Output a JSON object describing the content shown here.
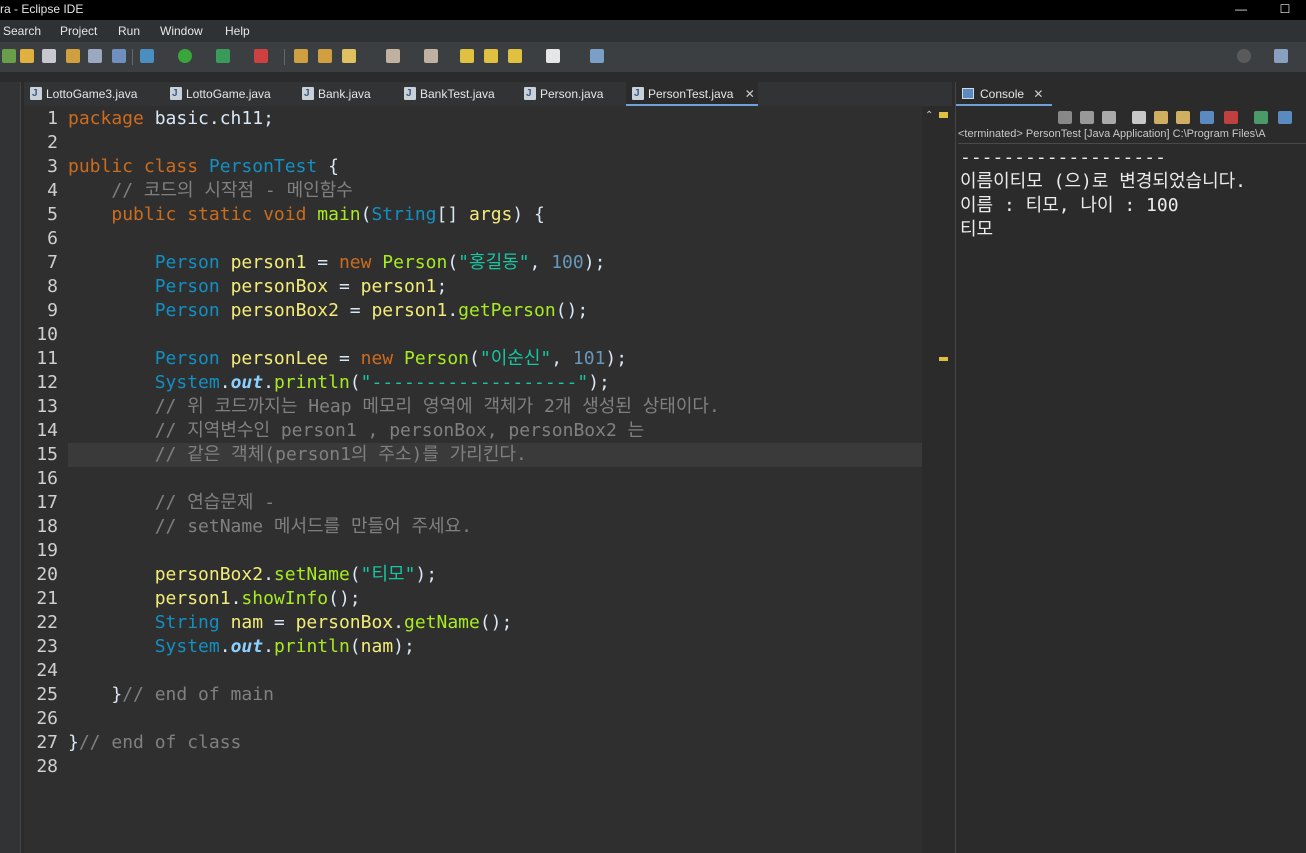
{
  "window": {
    "title": "ra - Eclipse IDE",
    "minimize": "—",
    "maximize": "☐"
  },
  "menu": [
    "Search",
    "Project",
    "Run",
    "Window",
    "Help"
  ],
  "editor_tabs": [
    {
      "label": "LottoGame3.java",
      "active": false
    },
    {
      "label": "LottoGame.java",
      "active": false
    },
    {
      "label": "Bank.java",
      "active": false
    },
    {
      "label": "BankTest.java",
      "active": false
    },
    {
      "label": "Person.java",
      "active": false
    },
    {
      "label": "PersonTest.java",
      "active": true
    }
  ],
  "tab_close": "✕",
  "code_lines": [
    {
      "n": "1",
      "tokens": [
        [
          "kw",
          "package"
        ],
        [
          "plain",
          " basic.ch11;"
        ]
      ]
    },
    {
      "n": "2",
      "tokens": []
    },
    {
      "n": "3",
      "tokens": [
        [
          "kw",
          "public class "
        ],
        [
          "cls",
          "PersonTest"
        ],
        [
          "plain",
          " {"
        ]
      ]
    },
    {
      "n": "4",
      "tokens": [
        [
          "plain",
          "    "
        ],
        [
          "cm",
          "// 코드의 시작점 - 메인함수"
        ]
      ]
    },
    {
      "n": "5",
      "tokens": [
        [
          "plain",
          "    "
        ],
        [
          "kw",
          "public static void "
        ],
        [
          "mth",
          "main"
        ],
        [
          "plain",
          "("
        ],
        [
          "ty",
          "String"
        ],
        [
          "plain",
          "[] "
        ],
        [
          "var",
          "args"
        ],
        [
          "plain",
          ") {"
        ]
      ]
    },
    {
      "n": "6",
      "tokens": []
    },
    {
      "n": "7",
      "tokens": [
        [
          "plain",
          "        "
        ],
        [
          "ty",
          "Person "
        ],
        [
          "var",
          "person1"
        ],
        [
          "plain",
          " = "
        ],
        [
          "kw",
          "new "
        ],
        [
          "mth",
          "Person"
        ],
        [
          "plain",
          "("
        ],
        [
          "str",
          "\"홍길동\""
        ],
        [
          "plain",
          ", "
        ],
        [
          "num",
          "100"
        ],
        [
          "plain",
          ");"
        ]
      ]
    },
    {
      "n": "8",
      "tokens": [
        [
          "plain",
          "        "
        ],
        [
          "ty",
          "Person "
        ],
        [
          "var",
          "personBox"
        ],
        [
          "plain",
          " = "
        ],
        [
          "var",
          "person1"
        ],
        [
          "plain",
          ";"
        ]
      ]
    },
    {
      "n": "9",
      "tokens": [
        [
          "plain",
          "        "
        ],
        [
          "ty",
          "Person "
        ],
        [
          "var",
          "personBox2"
        ],
        [
          "plain",
          " = "
        ],
        [
          "var",
          "person1"
        ],
        [
          "plain",
          "."
        ],
        [
          "mth",
          "getPerson"
        ],
        [
          "plain",
          "();"
        ]
      ]
    },
    {
      "n": "10",
      "tokens": []
    },
    {
      "n": "11",
      "tokens": [
        [
          "plain",
          "        "
        ],
        [
          "ty",
          "Person "
        ],
        [
          "var",
          "personLee"
        ],
        [
          "plain",
          " = "
        ],
        [
          "kw",
          "new "
        ],
        [
          "mth",
          "Person"
        ],
        [
          "plain",
          "("
        ],
        [
          "str",
          "\"이순신\""
        ],
        [
          "plain",
          ", "
        ],
        [
          "num",
          "101"
        ],
        [
          "plain",
          ");"
        ]
      ]
    },
    {
      "n": "12",
      "tokens": [
        [
          "plain",
          "        "
        ],
        [
          "ty",
          "System"
        ],
        [
          "plain",
          "."
        ],
        [
          "sfld",
          "out"
        ],
        [
          "plain",
          "."
        ],
        [
          "mth",
          "println"
        ],
        [
          "plain",
          "("
        ],
        [
          "str",
          "\"-------------------\""
        ],
        [
          "plain",
          ");"
        ]
      ]
    },
    {
      "n": "13",
      "tokens": [
        [
          "plain",
          "        "
        ],
        [
          "cm",
          "// 위 코드까지는 Heap 메모리 영역에 객체가 2개 생성된 상태이다."
        ]
      ]
    },
    {
      "n": "14",
      "tokens": [
        [
          "plain",
          "        "
        ],
        [
          "cm",
          "// 지역변수인 person1 , personBox, personBox2 는"
        ]
      ]
    },
    {
      "n": "15",
      "tokens": [
        [
          "plain",
          "        "
        ],
        [
          "cm",
          "// 같은 객체(person1의 주소)를 가리킨다."
        ]
      ]
    },
    {
      "n": "16",
      "tokens": []
    },
    {
      "n": "17",
      "tokens": [
        [
          "plain",
          "        "
        ],
        [
          "cm",
          "// 연습문제 -"
        ]
      ]
    },
    {
      "n": "18",
      "tokens": [
        [
          "plain",
          "        "
        ],
        [
          "cm",
          "// setName 메서드를 만들어 주세요."
        ]
      ]
    },
    {
      "n": "19",
      "tokens": []
    },
    {
      "n": "20",
      "tokens": [
        [
          "plain",
          "        "
        ],
        [
          "var",
          "personBox2"
        ],
        [
          "plain",
          "."
        ],
        [
          "mth",
          "setName"
        ],
        [
          "plain",
          "("
        ],
        [
          "str",
          "\"티모\""
        ],
        [
          "plain",
          ");"
        ]
      ]
    },
    {
      "n": "21",
      "tokens": [
        [
          "plain",
          "        "
        ],
        [
          "var",
          "person1"
        ],
        [
          "plain",
          "."
        ],
        [
          "mth",
          "showInfo"
        ],
        [
          "plain",
          "();"
        ]
      ]
    },
    {
      "n": "22",
      "tokens": [
        [
          "plain",
          "        "
        ],
        [
          "ty",
          "String "
        ],
        [
          "var",
          "nam"
        ],
        [
          "plain",
          " = "
        ],
        [
          "var",
          "personBox"
        ],
        [
          "plain",
          "."
        ],
        [
          "mth",
          "getName"
        ],
        [
          "plain",
          "();"
        ]
      ]
    },
    {
      "n": "23",
      "tokens": [
        [
          "plain",
          "        "
        ],
        [
          "ty",
          "System"
        ],
        [
          "plain",
          "."
        ],
        [
          "sfld",
          "out"
        ],
        [
          "plain",
          "."
        ],
        [
          "mth",
          "println"
        ],
        [
          "plain",
          "("
        ],
        [
          "var",
          "nam"
        ],
        [
          "plain",
          ");"
        ]
      ]
    },
    {
      "n": "24",
      "tokens": []
    },
    {
      "n": "25",
      "tokens": [
        [
          "plain",
          "    }"
        ],
        [
          "cm",
          "// end of main"
        ]
      ]
    },
    {
      "n": "26",
      "tokens": []
    },
    {
      "n": "27",
      "tokens": [
        [
          "plain",
          "}"
        ],
        [
          "cm",
          "// end of class"
        ]
      ]
    },
    {
      "n": "28",
      "tokens": []
    }
  ],
  "highlighted_line": "15",
  "console": {
    "tab_label": "Console",
    "status": "<terminated> PersonTest [Java Application] C:\\Program Files\\A",
    "output": [
      "-------------------",
      "이름이티모 (으)로 변경되었습니다.",
      "이름 : 티모, 나이 : 100",
      "티모"
    ]
  },
  "colors": {
    "editor_bg": "#2f2f2f",
    "keyword": "#cc6c1d",
    "type": "#1290c3",
    "string": "#17c6a3",
    "comment": "#808080",
    "method": "#a7ec21",
    "variable": "#f3ec79"
  }
}
